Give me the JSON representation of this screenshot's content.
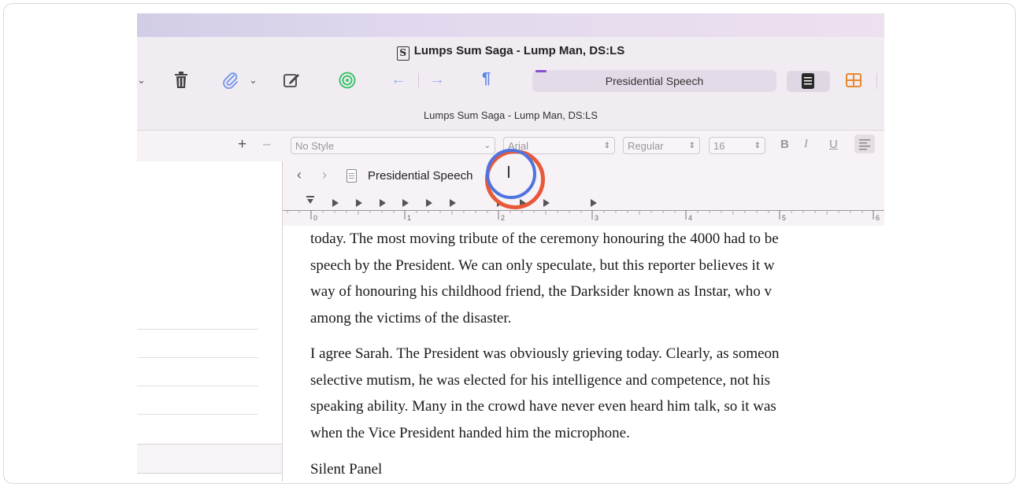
{
  "window": {
    "title": "Lumps Sum Saga - Lump Man, DS:LS",
    "subtitle": "Lumps Sum Saga - Lump Man, DS:LS",
    "doc_glyph": "S"
  },
  "toolbar": {
    "search_value": "Presidential Speech",
    "icons": [
      "chevron-down-icon",
      "trash-icon",
      "paperclip-icon",
      "compose-icon",
      "target-icon",
      "back-arrow-icon",
      "forward-arrow-icon",
      "pilcrow-icon",
      "document-view-icon",
      "corkboard-icon"
    ]
  },
  "sidebar": {
    "plus": "+",
    "minus": "–"
  },
  "format": {
    "style": "No Style",
    "font": "Arial",
    "weight": "Regular",
    "size": "16",
    "bold": "B",
    "italic": "I",
    "underline": "U"
  },
  "editor_header": {
    "doc_title": "Presidential Speech"
  },
  "ruler": {
    "labels": [
      "0",
      "1",
      "2",
      "3",
      "4",
      "5",
      "6"
    ]
  },
  "body": {
    "p1": [
      "today. The most moving tribute of the ceremony honouring the 4000 had to be",
      "speech by the President. We can only speculate, but this reporter believes it w",
      "way of honouring his childhood friend, the Darksider known as Instar, who v",
      "among the victims of the disaster."
    ],
    "p2": [
      "I agree Sarah. The President was obviously grieving today. Clearly, as someon",
      "selective mutism, he was elected for his intelligence and competence, not his",
      "speaking ability. Many in the crowd have never even heard him talk, so it was",
      "when the Vice President handed him the microphone."
    ],
    "p3": "Silent Panel"
  }
}
